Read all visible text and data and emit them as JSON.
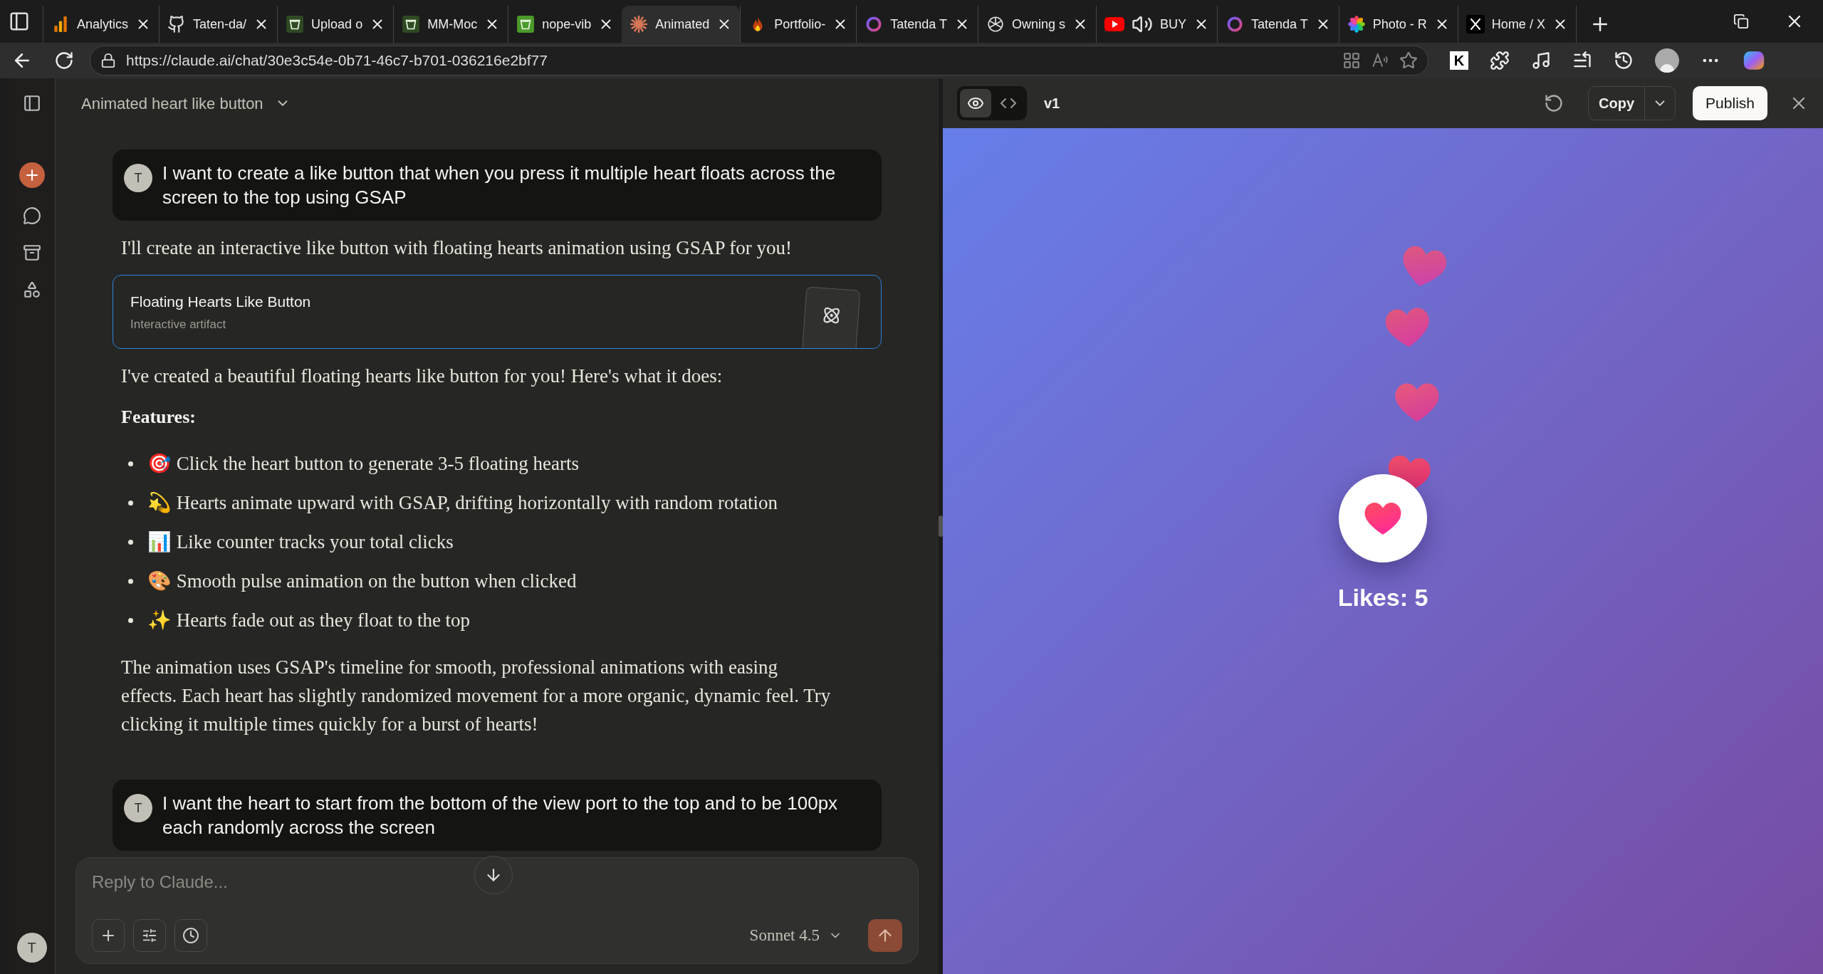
{
  "browser": {
    "tabs": [
      {
        "title": "Analytics",
        "selected": false
      },
      {
        "title": "Taten-da/",
        "selected": false
      },
      {
        "title": "Upload o",
        "selected": false
      },
      {
        "title": "MM-Moc",
        "selected": false
      },
      {
        "title": "nope-vib",
        "selected": false
      },
      {
        "title": "Animated",
        "selected": true
      },
      {
        "title": "Portfolio-",
        "selected": false
      },
      {
        "title": "Tatenda T",
        "selected": false
      },
      {
        "title": "Owning s",
        "selected": false
      },
      {
        "title": "BUY",
        "selected": false
      },
      {
        "title": "Tatenda T",
        "selected": false
      },
      {
        "title": "Photo - R",
        "selected": false
      },
      {
        "title": "Home / X",
        "selected": false
      }
    ],
    "url": "https://claude.ai/chat/30e3c54e-0b71-46c7-b701-036216e2bf77",
    "extension_label": "K"
  },
  "sidebar": {
    "avatar": "T"
  },
  "chat": {
    "title": "Animated heart like button",
    "conversation": [
      {
        "kind": "user",
        "avatar": "T",
        "text": "I want to create a like button that when you press it multiple heart floats across the screen to the top using GSAP"
      },
      {
        "kind": "paragraph",
        "text": "I'll create an interactive like button with floating hearts animation using GSAP for you!"
      },
      {
        "kind": "artifact",
        "title": "Floating Hearts Like Button",
        "subtitle": "Interactive artifact"
      },
      {
        "kind": "paragraph",
        "text": "I've created a beautiful floating hearts like button for you! Here's what it does:"
      },
      {
        "kind": "heading",
        "text": "Features:"
      },
      {
        "kind": "bullets",
        "items": [
          "🎯 Click the heart button to generate 3-5 floating hearts",
          "💫 Hearts animate upward with GSAP, drifting horizontally with random rotation",
          "📊 Like counter tracks your total clicks",
          "🎨 Smooth pulse animation on the button when clicked",
          "✨ Hearts fade out as they float to the top"
        ]
      },
      {
        "kind": "paragraph",
        "text": "The animation uses GSAP's timeline for smooth, professional animations with easing effects. Each heart has slightly randomized movement for a more organic, dynamic feel. Try clicking it multiple times quickly for a burst of hearts!"
      },
      {
        "kind": "user",
        "avatar": "T",
        "text": "I want the heart to start from the bottom of the view port to the top and to be 100px each randomly across the screen"
      }
    ],
    "composer": {
      "placeholder": "Reply to Claude...",
      "model": "Sonnet 4.5"
    }
  },
  "artifact_panel": {
    "views": [
      {
        "kind": "preview",
        "selected": true
      },
      {
        "kind": "code",
        "selected": false
      }
    ],
    "version": "v1",
    "copy": "Copy",
    "publish": "Publish",
    "likes": "Likes: 5"
  }
}
